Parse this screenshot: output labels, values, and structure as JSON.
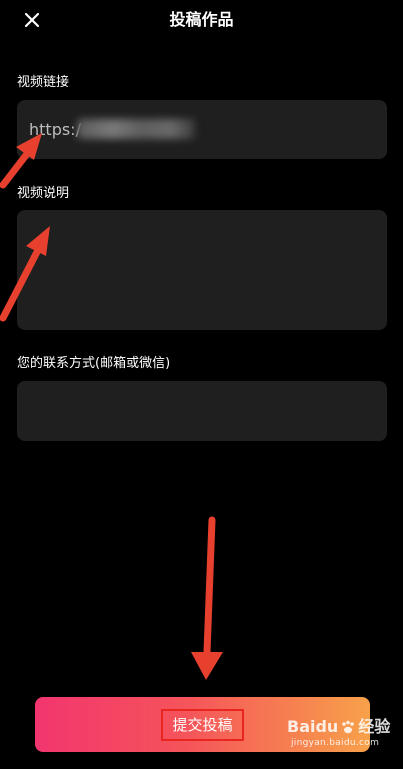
{
  "header": {
    "title": "投稿作品",
    "close_icon": "close-icon"
  },
  "form": {
    "video_link": {
      "label": "视频链接",
      "value": "https:/"
    },
    "video_desc": {
      "label": "视频说明",
      "value": ""
    },
    "contact": {
      "label": "您的联系方式(邮箱或微信)",
      "value": ""
    }
  },
  "submit": {
    "label": "提交投稿"
  },
  "watermark": {
    "brand": "Baidu",
    "suffix": "经验",
    "url": "jingyan.baidu.com"
  },
  "colors": {
    "background": "#000000",
    "field_background": "#1f1f1f",
    "button_gradient_start": "#f2356f",
    "button_gradient_end": "#f7a14a",
    "annotation_red": "#e8402e"
  }
}
